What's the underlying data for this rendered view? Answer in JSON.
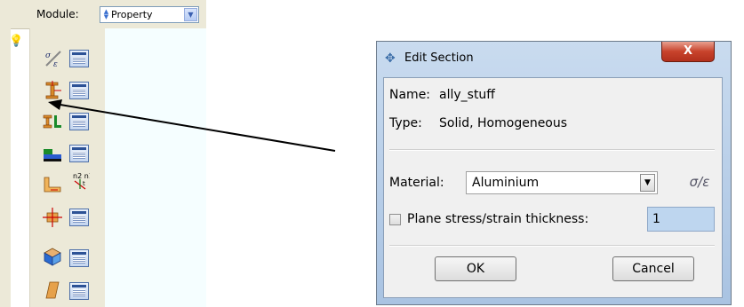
{
  "module_bar": {
    "label": "Module:",
    "value": "Property"
  },
  "dialog": {
    "title": "Edit Section",
    "close_glyph": "X",
    "name_label": "Name:",
    "name_value": "ally_stuff",
    "type_label": "Type:",
    "type_value": "Solid, Homogeneous",
    "material_label": "Material:",
    "material_value": "Aluminium",
    "material_button_glyph": "σ/ε",
    "thickness_label": "Plane stress/strain thickness:",
    "thickness_value": "1",
    "ok_label": "OK",
    "cancel_label": "Cancel"
  },
  "colors": {
    "toolbox_bg": "#ece9d8",
    "viewport_bg": "#f5feff",
    "dialog_frame": "#a9c3e2",
    "close_button": "#c8432c",
    "selected_field": "#bed6ef"
  },
  "toolbox_icons": [
    "material-create-icon",
    "material-manager-icon",
    "section-create-icon",
    "section-manager-icon",
    "beam-profile-create-icon",
    "profile-manager-icon",
    "composite-layup-icon",
    "layup-manager-icon",
    "skin-create-icon",
    "stringer-icon",
    "orientation-icon",
    "orientation-manager-icon",
    "assign-section-icon",
    "section-assignment-manager-icon",
    "special-create-icon",
    "special-manager-icon"
  ]
}
